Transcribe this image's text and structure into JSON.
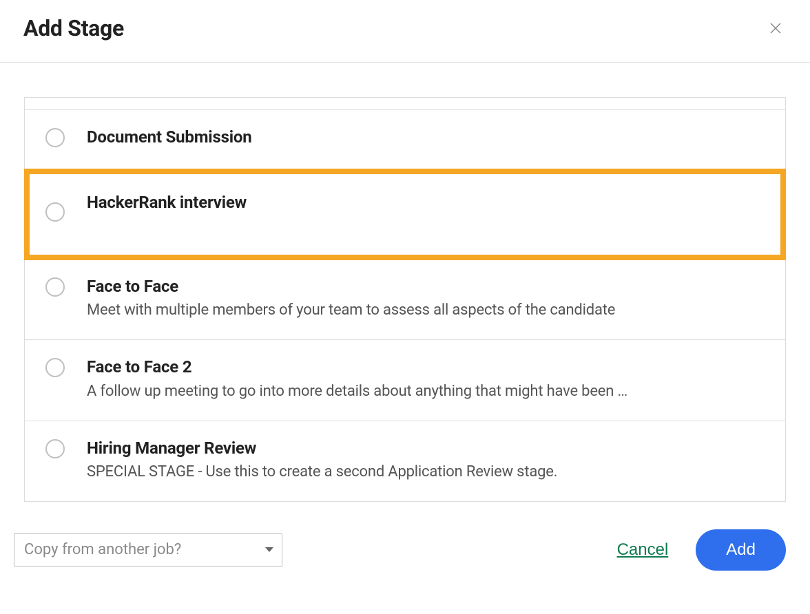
{
  "header": {
    "title": "Add Stage"
  },
  "stages": [
    {
      "title": "Document Submission",
      "description": "",
      "highlighted": false
    },
    {
      "title": "HackerRank interview",
      "description": "",
      "highlighted": true
    },
    {
      "title": "Face to Face",
      "description": "Meet with multiple members of your team to assess all aspects of the candidate",
      "highlighted": false
    },
    {
      "title": "Face to Face 2",
      "description": "A follow up meeting to go into more details about anything that might have been …",
      "highlighted": false
    },
    {
      "title": "Hiring Manager Review",
      "description": "SPECIAL STAGE - Use this to create a second Application Review stage.",
      "highlighted": false
    }
  ],
  "footer": {
    "copy_from_label": "Copy from another job?",
    "cancel_label": "Cancel",
    "add_label": "Add"
  }
}
